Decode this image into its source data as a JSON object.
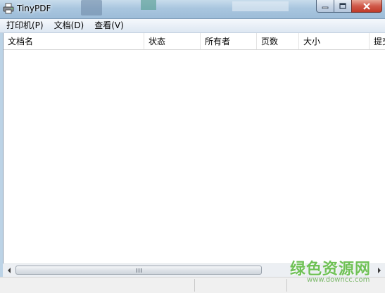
{
  "window": {
    "title": "TinyPDF"
  },
  "menu": {
    "items": [
      {
        "label": "打印机(P)"
      },
      {
        "label": "文档(D)"
      },
      {
        "label": "查看(V)"
      }
    ]
  },
  "list": {
    "columns": [
      "文档名",
      "状态",
      "所有者",
      "页数",
      "大小",
      "提交"
    ],
    "rows": []
  },
  "icons": {
    "app": "printer-icon",
    "scroll_left": "arrow-left-icon",
    "scroll_right": "arrow-right-icon",
    "thumb_grip": "grip-icon"
  },
  "watermark": {
    "main": "绿色资源网",
    "sub": "www.downcc.com"
  },
  "colors": {
    "watermark": "#6fc156",
    "close_button": "#c94b3a"
  }
}
